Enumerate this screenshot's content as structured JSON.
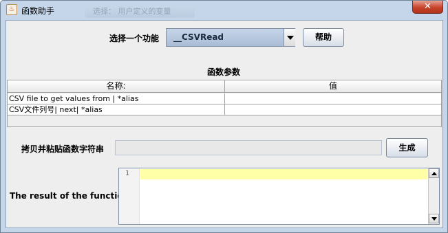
{
  "window": {
    "title": "函数助手",
    "background_tab": "选择：   用户定义的变量",
    "close_glyph": "✕",
    "icon_glyph": "♨"
  },
  "function_select": {
    "label": "选择一个功能",
    "value": "__CSVRead"
  },
  "help_button": {
    "label": "帮助"
  },
  "params": {
    "title": "函数参数",
    "columns": [
      "名称:",
      "值"
    ],
    "rows": [
      {
        "name": "CSV file to get values from | *alias",
        "value": ""
      },
      {
        "name": "CSV文件列号| next| *alias",
        "value": ""
      }
    ]
  },
  "copy": {
    "label": "拷贝并粘贴函数字符串",
    "value": ""
  },
  "generate_button": {
    "label": "生成"
  },
  "result": {
    "label": "The result of the function is",
    "line_number": "1",
    "text": ""
  },
  "colors": {
    "title_bar": "#c5d6ea",
    "close_button": "#c7432b",
    "line_highlight": "#ffff99",
    "panel": "#eeeeee"
  }
}
